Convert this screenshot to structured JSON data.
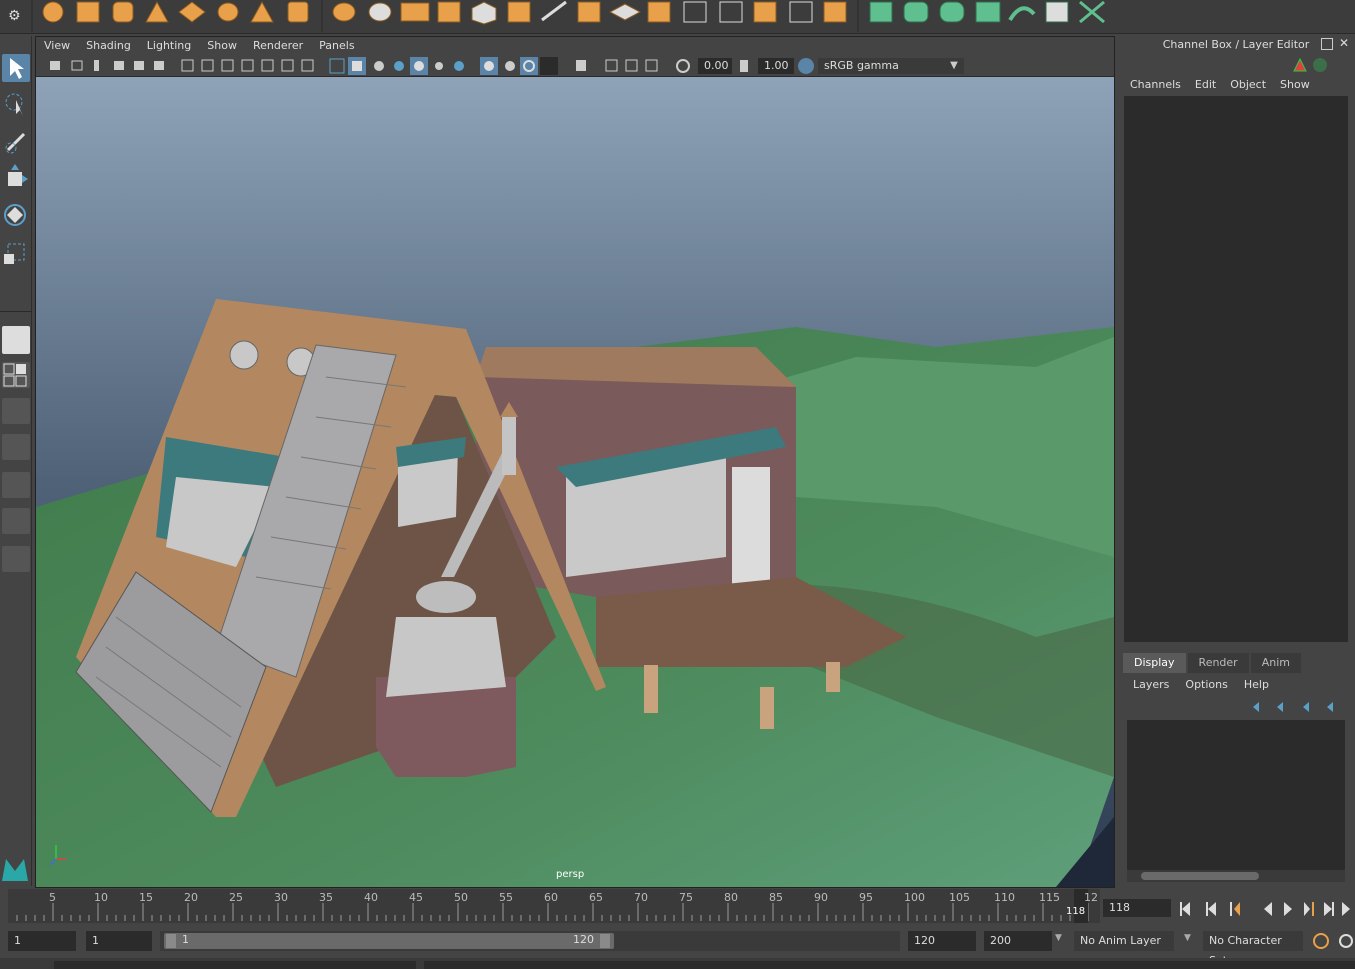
{
  "viewport": {
    "menu": [
      "View",
      "Shading",
      "Lighting",
      "Show",
      "Renderer",
      "Panels"
    ],
    "exposure_value": "0.00",
    "gamma_value": "1.00",
    "color_space": "sRGB gamma",
    "camera_label": "persp"
  },
  "channel_box": {
    "title": "Channel Box / Layer Editor",
    "menu": [
      "Channels",
      "Edit",
      "Object",
      "Show"
    ]
  },
  "layer_editor": {
    "tabs": [
      "Display",
      "Render",
      "Anim"
    ],
    "active_tab": "Display",
    "menu": [
      "Layers",
      "Options",
      "Help"
    ]
  },
  "timeline": {
    "ticks": [
      "5",
      "10",
      "15",
      "20",
      "25",
      "30",
      "35",
      "40",
      "45",
      "50",
      "55",
      "60",
      "65",
      "70",
      "75",
      "80",
      "85",
      "90",
      "95",
      "100",
      "105",
      "110",
      "115",
      "12"
    ],
    "playhead_label": "118",
    "current_frame": "118"
  },
  "range": {
    "start_frame": "1",
    "playback_start": "1",
    "slider_start": "1",
    "slider_end": "120",
    "playback_end": "120",
    "end_frame": "200",
    "anim_layer": "No Anim Layer",
    "character_set": "No Character Set"
  },
  "colors": {
    "accent": "#5aa0c8",
    "shelf_orange": "#e9a04a",
    "shelf_green": "#5fbf8e"
  }
}
